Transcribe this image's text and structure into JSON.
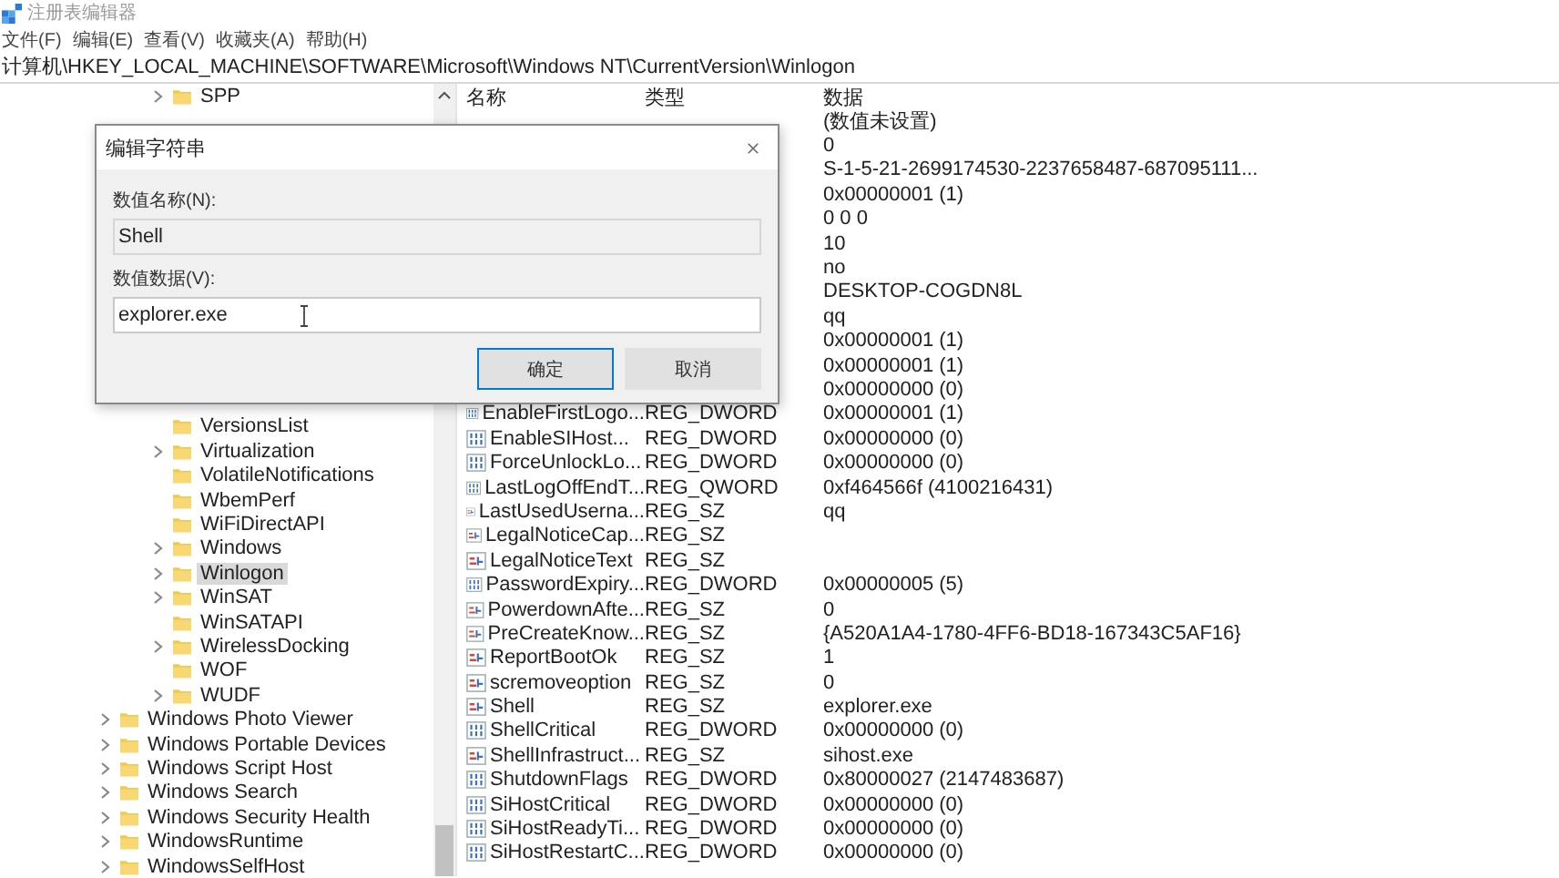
{
  "window": {
    "title": "注册表编辑器"
  },
  "menu": [
    "文件(F)",
    "编辑(E)",
    "查看(V)",
    "收藏夹(A)",
    "帮助(H)"
  ],
  "address": "计算机\\HKEY_LOCAL_MACHINE\\SOFTWARE\\Microsoft\\Windows NT\\CurrentVersion\\Winlogon",
  "tree": {
    "current_version_keys_top": [
      {
        "label": "SPP",
        "expandable": true,
        "selected": false
      }
    ],
    "current_version_keys": [
      {
        "label": "VersionsList",
        "expandable": false,
        "selected": false
      },
      {
        "label": "Virtualization",
        "expandable": true,
        "selected": false
      },
      {
        "label": "VolatileNotifications",
        "expandable": false,
        "selected": false
      },
      {
        "label": "WbemPerf",
        "expandable": false,
        "selected": false
      },
      {
        "label": "WiFiDirectAPI",
        "expandable": false,
        "selected": false
      },
      {
        "label": "Windows",
        "expandable": true,
        "selected": false
      },
      {
        "label": "Winlogon",
        "expandable": true,
        "selected": true
      },
      {
        "label": "WinSAT",
        "expandable": true,
        "selected": false
      },
      {
        "label": "WinSATAPI",
        "expandable": false,
        "selected": false
      },
      {
        "label": "WirelessDocking",
        "expandable": true,
        "selected": false
      },
      {
        "label": "WOF",
        "expandable": false,
        "selected": false
      },
      {
        "label": "WUDF",
        "expandable": true,
        "selected": false
      }
    ],
    "microsoft_keys": [
      {
        "label": "Windows Photo Viewer",
        "expandable": true,
        "selected": false
      },
      {
        "label": "Windows Portable Devices",
        "expandable": true,
        "selected": false
      },
      {
        "label": "Windows Script Host",
        "expandable": true,
        "selected": false
      },
      {
        "label": "Windows Search",
        "expandable": true,
        "selected": false
      },
      {
        "label": "Windows Security Health",
        "expandable": true,
        "selected": false
      },
      {
        "label": "WindowsRuntime",
        "expandable": true,
        "selected": false
      },
      {
        "label": "WindowsSelfHost",
        "expandable": true,
        "selected": false
      }
    ]
  },
  "table": {
    "columns": [
      "名称",
      "类型",
      "数据"
    ],
    "rows": [
      {
        "data": "(数值未设置)"
      },
      {
        "data": "0"
      },
      {
        "data": "S-1-5-21-2699174530-2237658487-687095111..."
      },
      {
        "data": "0x00000001 (1)"
      },
      {
        "data": "0 0 0"
      },
      {
        "data": "10"
      },
      {
        "data": "no"
      },
      {
        "data": "DESKTOP-COGDN8L"
      },
      {
        "data": "qq"
      },
      {
        "data": "0x00000001 (1)"
      },
      {
        "data": "0x00000001 (1)"
      },
      {
        "data": "0x00000000 (0)"
      },
      {
        "kind": "binary",
        "name": "EnableFirstLogo...",
        "type": "REG_DWORD",
        "data": "0x00000001 (1)"
      },
      {
        "kind": "binary",
        "name": "EnableSIHost...",
        "type": "REG_DWORD",
        "data": "0x00000000 (0)"
      },
      {
        "kind": "binary",
        "name": "ForceUnlockLo...",
        "type": "REG_DWORD",
        "data": "0x00000000 (0)"
      },
      {
        "kind": "binary",
        "name": "LastLogOffEndT...",
        "type": "REG_QWORD",
        "data": "0xf464566f (4100216431)"
      },
      {
        "kind": "string",
        "name": "LastUsedUserna...",
        "type": "REG_SZ",
        "data": "qq"
      },
      {
        "kind": "string",
        "name": "LegalNoticeCap...",
        "type": "REG_SZ"
      },
      {
        "kind": "string",
        "name": "LegalNoticeText",
        "type": "REG_SZ"
      },
      {
        "kind": "binary",
        "name": "PasswordExpiry...",
        "type": "REG_DWORD",
        "data": "0x00000005 (5)"
      },
      {
        "kind": "string",
        "name": "PowerdownAfte...",
        "type": "REG_SZ",
        "data": "0"
      },
      {
        "kind": "string",
        "name": "PreCreateKnow...",
        "type": "REG_SZ",
        "data": "{A520A1A4-1780-4FF6-BD18-167343C5AF16}"
      },
      {
        "kind": "string",
        "name": "ReportBootOk",
        "type": "REG_SZ",
        "data": "1"
      },
      {
        "kind": "string",
        "name": "scremoveoption",
        "type": "REG_SZ",
        "data": "0"
      },
      {
        "kind": "string",
        "name": "Shell",
        "type": "REG_SZ",
        "data": "explorer.exe"
      },
      {
        "kind": "binary",
        "name": "ShellCritical",
        "type": "REG_DWORD",
        "data": "0x00000000 (0)"
      },
      {
        "kind": "string",
        "name": "ShellInfrastruct...",
        "type": "REG_SZ",
        "data": "sihost.exe"
      },
      {
        "kind": "binary",
        "name": "ShutdownFlags",
        "type": "REG_DWORD",
        "data": "0x80000027 (2147483687)"
      },
      {
        "kind": "binary",
        "name": "SiHostCritical",
        "type": "REG_DWORD",
        "data": "0x00000000 (0)"
      },
      {
        "kind": "binary",
        "name": "SiHostReadyTi...",
        "type": "REG_DWORD",
        "data": "0x00000000 (0)"
      },
      {
        "kind": "binary",
        "name": "SiHostRestartC...",
        "type": "REG_DWORD",
        "data": "0x00000000 (0)"
      }
    ]
  },
  "dialog": {
    "title": "编辑字符串",
    "name_label": "数值名称(N):",
    "name_value": "Shell",
    "data_label": "数值数据(V):",
    "data_value": "explorer.exe",
    "buttons": [
      {
        "label": "确定",
        "focused": true
      },
      {
        "label": "取消",
        "focused": false
      }
    ]
  }
}
